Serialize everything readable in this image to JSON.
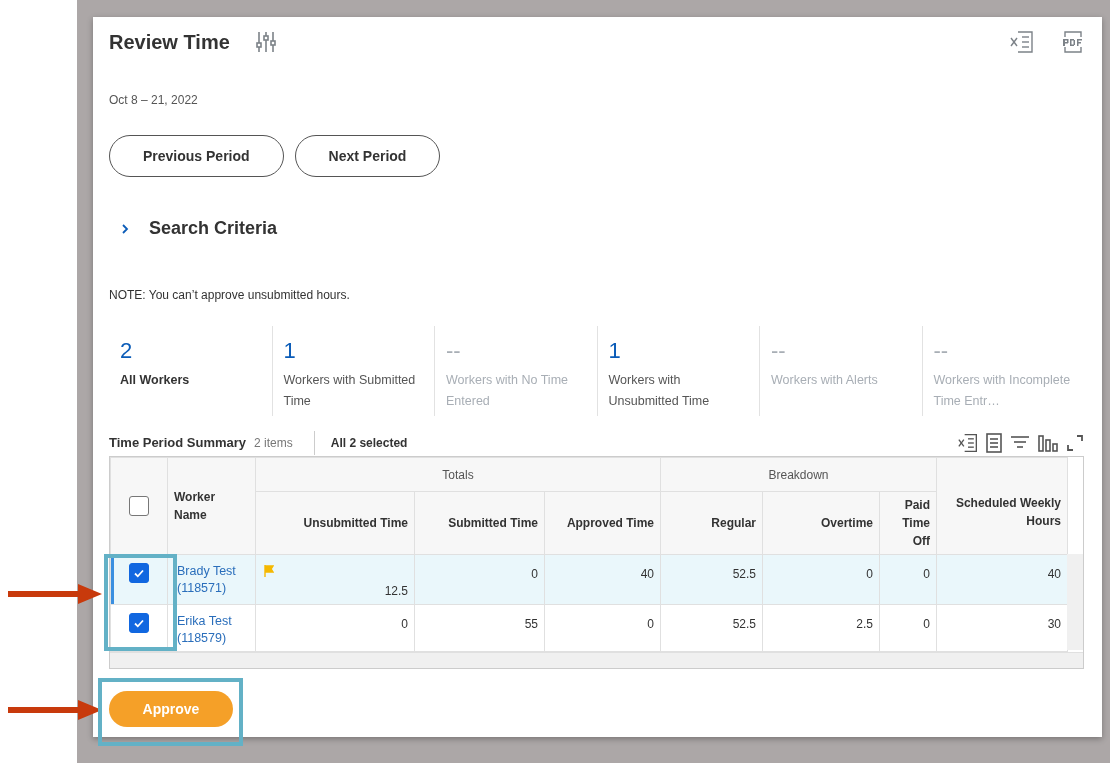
{
  "page": {
    "title": "Review Time",
    "date_range": "Oct 8 – 21, 2022"
  },
  "period_buttons": [
    "Previous Period",
    "Next Period"
  ],
  "search_criteria": {
    "label": "Search Criteria",
    "expanded": false
  },
  "note": "NOTE: You can’t approve unsubmitted hours.",
  "tiles": [
    {
      "count": "2",
      "label": "All Workers",
      "selected": true,
      "disabled": false
    },
    {
      "count": "1",
      "label": "Workers with Submitted Time",
      "selected": false,
      "disabled": false
    },
    {
      "count": "--",
      "label": "Workers with No Time Entered",
      "selected": false,
      "disabled": true
    },
    {
      "count": "1",
      "label": "Workers with Unsubmitted Time",
      "selected": false,
      "disabled": false
    },
    {
      "count": "--",
      "label": "Workers with Alerts",
      "selected": false,
      "disabled": true
    },
    {
      "count": "--",
      "label": "Workers with Incomplete Time Entr…",
      "selected": false,
      "disabled": true
    }
  ],
  "summary": {
    "title": "Time Period Summary",
    "count": "2 items",
    "selection": "All 2 selected"
  },
  "table": {
    "select_all_checked": false,
    "columns": [
      {
        "label": "Worker Name"
      },
      {
        "label": "Totals",
        "children": [
          {
            "label": "Unsubmitted Time"
          },
          {
            "label": "Submitted Time"
          },
          {
            "label": "Approved Time"
          }
        ]
      },
      {
        "label": "Breakdown",
        "children": [
          {
            "label": "Regular"
          },
          {
            "label": "Overtime"
          },
          {
            "label": "Paid Time Off"
          }
        ]
      },
      {
        "label": "Scheduled Weekly Hours"
      }
    ],
    "rows": [
      {
        "selected": true,
        "checked": true,
        "flagged": true,
        "worker": "Brady Test (118571)",
        "values": [
          "12.5",
          "0",
          "40",
          "52.5",
          "0",
          "0",
          "40"
        ]
      },
      {
        "selected": false,
        "checked": true,
        "flagged": false,
        "worker": "Erika Test (118579)",
        "values": [
          "0",
          "55",
          "0",
          "52.5",
          "2.5",
          "0",
          "30"
        ]
      }
    ]
  },
  "approve_button": "Approve"
}
